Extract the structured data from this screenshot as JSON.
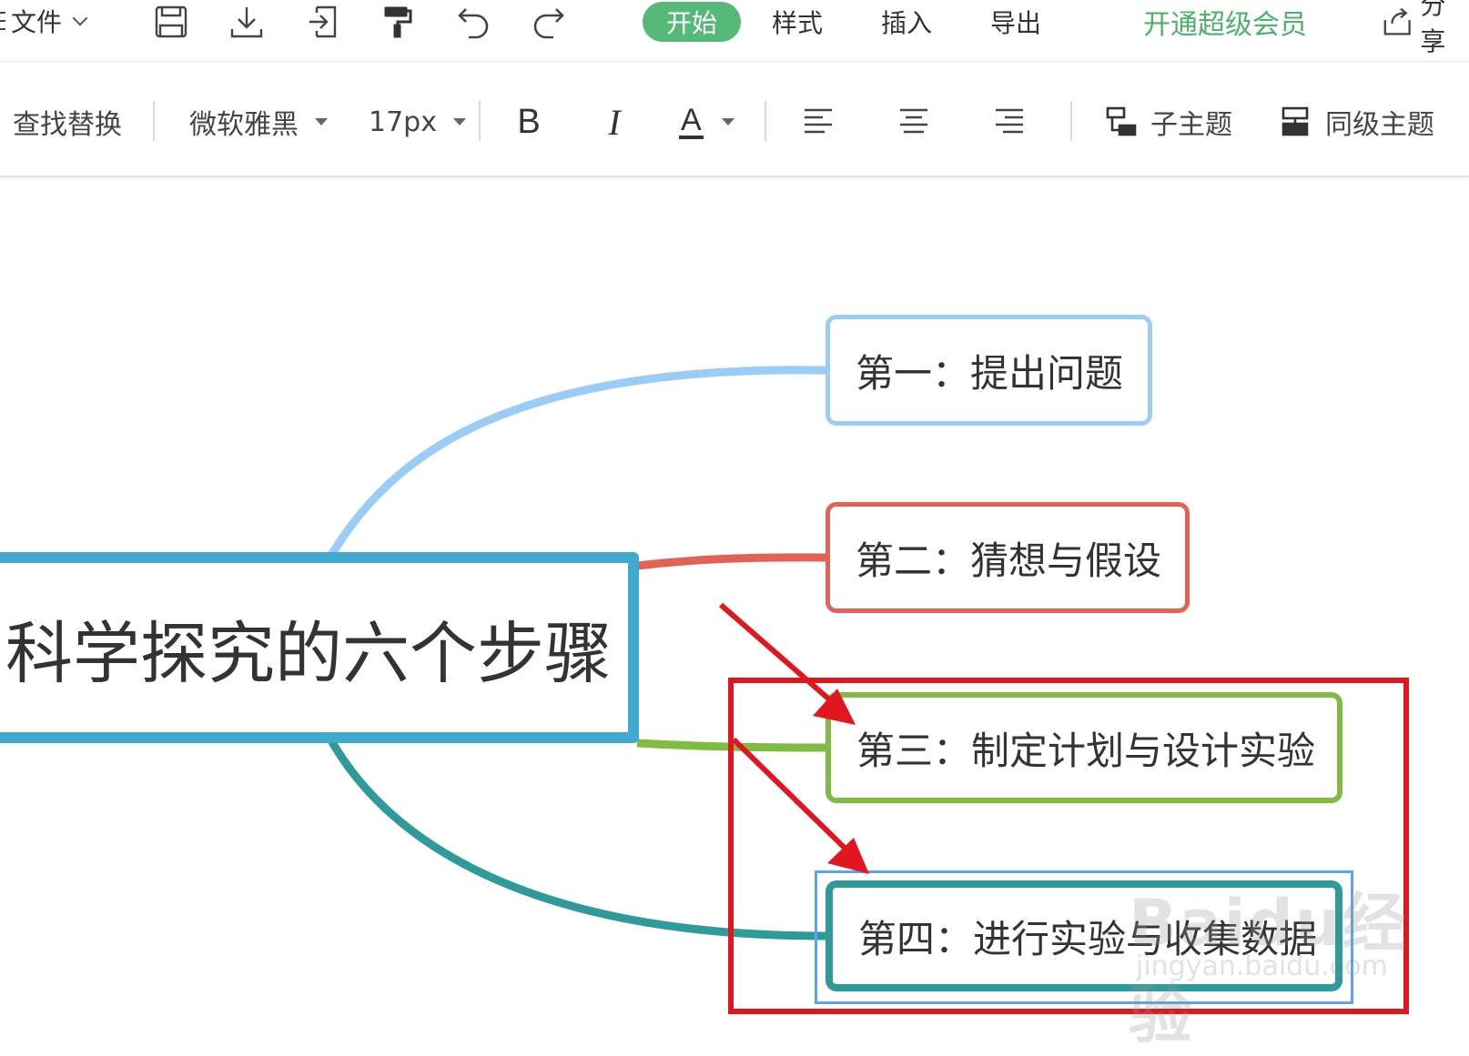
{
  "menubar": {
    "file_label": "文件",
    "tabs": [
      {
        "label": "开始",
        "active": true
      },
      {
        "label": "样式",
        "active": false
      },
      {
        "label": "插入",
        "active": false
      },
      {
        "label": "导出",
        "active": false
      }
    ],
    "vip_label": "开通超级会员",
    "share_label": "分享",
    "icons": [
      "save-icon",
      "download-icon",
      "import-icon",
      "format-painter-icon",
      "undo-icon",
      "redo-icon"
    ]
  },
  "toolbar": {
    "find_replace": "查找替换",
    "font_family": "微软雅黑",
    "font_size": "17px",
    "bold": "B",
    "italic": "I",
    "font_color": "A",
    "child_topic": "子主题",
    "sibling_topic": "同级主题"
  },
  "mindmap": {
    "root": "科学探究的六个步骤",
    "children": [
      {
        "label": "第一：提出问题",
        "color": "#99ccf7"
      },
      {
        "label": "第二：猜想与假设",
        "color": "#e46255"
      },
      {
        "label": "第三：制定计划与设计实验",
        "color": "#80bc42"
      },
      {
        "label": "第四：进行实验与收集数据",
        "color": "#2f9a9a"
      }
    ],
    "root_color": "#3fa9cf",
    "accent": "#55b97a"
  },
  "watermark": {
    "brand": "Baidu经验",
    "url": "jingyan.baidu.com"
  }
}
